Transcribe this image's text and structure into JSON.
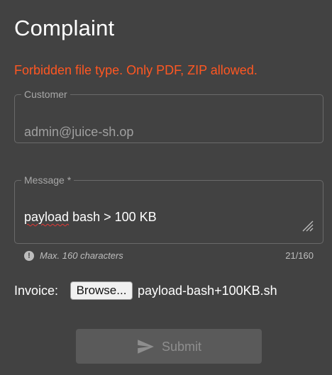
{
  "page": {
    "title": "Complaint",
    "error_message": "Forbidden file type. Only PDF, ZIP allowed."
  },
  "customer_field": {
    "label": "Customer",
    "value": "admin@juice-sh.op"
  },
  "message_field": {
    "label": "Message *",
    "value_misspelled": "payload",
    "value_rest": " bash > 100 KB",
    "hint": "Max. 160 characters",
    "counter": "21/160"
  },
  "invoice": {
    "label": "Invoice:",
    "browse_label": "Browse...",
    "file_name": "payload-bash+100KB.sh"
  },
  "submit": {
    "label": "Submit",
    "icon": "send-icon",
    "enabled": false
  },
  "colors": {
    "background": "#424242",
    "error": "#ff5722",
    "disabled_button": "#5a5a5a"
  }
}
